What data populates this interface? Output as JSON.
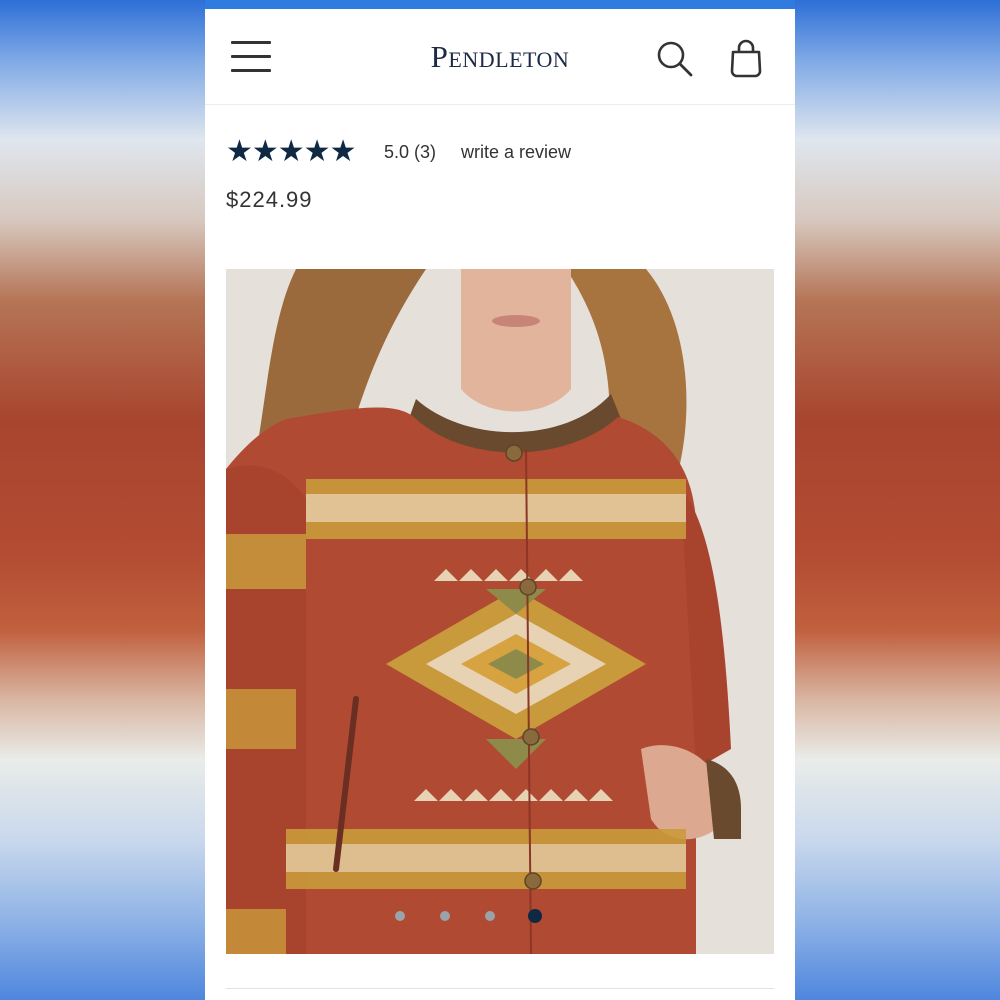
{
  "brand": {
    "logo_text": "Pendleton"
  },
  "header": {
    "menu_icon": "hamburger-menu-icon",
    "search_icon": "search-icon",
    "bag_icon": "shopping-bag-icon"
  },
  "product": {
    "rating_stars": "★★★★★",
    "rating": "5.0",
    "review_count": "(3)",
    "review_link": "write a review",
    "price": "$224.99",
    "image_description_icon": "product-photo",
    "carousel": {
      "total": 4,
      "active_index": 4
    }
  },
  "colors": {
    "accent_bar": "#2f7be0",
    "navy": "#0f2844",
    "jacket_red": "#b04a33",
    "pattern_gold": "#c99a3b",
    "pattern_cream": "#e8d2b4"
  }
}
